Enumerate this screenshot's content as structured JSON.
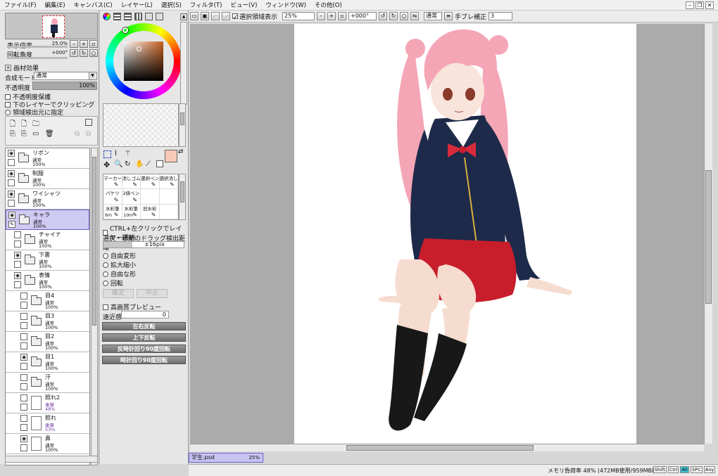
{
  "menu": [
    "ファイル(F)",
    "編集(E)",
    "キャンバス(C)",
    "レイヤー(L)",
    "選択(S)",
    "フィルタ(T)",
    "ビュー(V)",
    "ウィンドウ(W)",
    "その他(O)"
  ],
  "nav": {
    "zoom_label": "表示倍率",
    "zoom_value": "25.0%",
    "rotate_label": "回転角度",
    "rotate_value": "+000°"
  },
  "layer_props": {
    "effects_label": "画材効果",
    "blend_label": "合成モード",
    "blend_value": "通常",
    "opacity_label": "不透明度",
    "opacity_value": "100%",
    "opacity_fraction": 1.0,
    "options": [
      "不透明度保護",
      "下のレイヤーでクリッピング",
      "領域検出元に指定"
    ]
  },
  "layers": [
    {
      "name": "リボン",
      "mode": "通常",
      "opacity": "100%",
      "type": "folder",
      "visible": true,
      "indent": 0,
      "selected": false
    },
    {
      "name": "制服",
      "mode": "通常",
      "opacity": "100%",
      "type": "folder",
      "visible": true,
      "indent": 0,
      "selected": false
    },
    {
      "name": "ワイシャツ",
      "mode": "通常",
      "opacity": "100%",
      "type": "folder",
      "visible": true,
      "indent": 0,
      "selected": false
    },
    {
      "name": "キャラ",
      "mode": "通常",
      "opacity": "100%",
      "type": "folder-open",
      "visible": true,
      "indent": 0,
      "selected": true
    },
    {
      "name": "チャイナ",
      "mode": "通常",
      "opacity": "100%",
      "type": "folder",
      "visible": false,
      "indent": 1,
      "selected": false
    },
    {
      "name": "下書",
      "mode": "通常",
      "opacity": "100%",
      "type": "folder",
      "visible": true,
      "indent": 1,
      "selected": false
    },
    {
      "name": "表情",
      "mode": "通常",
      "opacity": "100%",
      "type": "folder-open",
      "visible": true,
      "indent": 1,
      "selected": false
    },
    {
      "name": "目4",
      "mode": "通常",
      "opacity": "100%",
      "type": "folder",
      "visible": false,
      "indent": 2,
      "selected": false
    },
    {
      "name": "目3",
      "mode": "通常",
      "opacity": "100%",
      "type": "folder",
      "visible": false,
      "indent": 2,
      "selected": false
    },
    {
      "name": "目2",
      "mode": "通常",
      "opacity": "100%",
      "type": "folder",
      "visible": false,
      "indent": 2,
      "selected": false
    },
    {
      "name": "目1",
      "mode": "通常",
      "opacity": "100%",
      "type": "folder",
      "visible": true,
      "indent": 2,
      "selected": false
    },
    {
      "name": "汗",
      "mode": "通常",
      "opacity": "100%",
      "type": "folder",
      "visible": false,
      "indent": 2,
      "selected": false
    },
    {
      "name": "照れ2",
      "mode": "乗算",
      "opacity": "48%",
      "type": "layer",
      "visible": false,
      "indent": 2,
      "selected": false
    },
    {
      "name": "照れ",
      "mode": "乗算",
      "opacity": "53%",
      "type": "layer",
      "visible": false,
      "indent": 2,
      "selected": false
    },
    {
      "name": "鼻",
      "mode": "通常",
      "opacity": "100%",
      "type": "layer",
      "visible": true,
      "indent": 2,
      "selected": false
    }
  ],
  "tools": {
    "brushes": [
      {
        "label": "マーカー"
      },
      {
        "label": "消しゴム"
      },
      {
        "label": "選択ペン"
      },
      {
        "label": "選択消し"
      },
      {
        "label": "バケツ"
      },
      {
        "label": "2値ペン"
      },
      {
        "label": ""
      },
      {
        "label": ""
      },
      {
        "label": "水彩筆",
        "sub": "9ｍ"
      },
      {
        "label": "水彩筆",
        "sub": "10ｍ"
      },
      {
        "label": "旧水彩"
      },
      {
        "label": ""
      }
    ],
    "ctrl_select": "CTRL+左クリックでレイヤー選択",
    "drag_label": "選択・移動のドラッグ検出距離",
    "drag_value": "±16pix",
    "transform_options": [
      "自由変形",
      "拡大縮小",
      "自由な形",
      "回転"
    ],
    "ok_label": "確定",
    "cancel_label": "中止",
    "hq_preview": "高画質プレビュー",
    "perspective_label": "遠近感",
    "perspective_value": "0",
    "actions": [
      "左右反転",
      "上下反転",
      "反時計回り90度回転",
      "時計回り90度回転"
    ]
  },
  "canvas_toolbar": {
    "show_selection": "選択領域表示",
    "zoom": "25%",
    "rotation": "+000°",
    "blend": "通常",
    "stabilizer_label": "手ブレ補正",
    "stabilizer_value": "3"
  },
  "document": {
    "tab_name": "学生.psd",
    "tab_zoom": "25%"
  },
  "status": {
    "memory": "メモリ負荷率 48% (472MB使用/959MB確保)",
    "keys": [
      "Shift",
      "Ctrl",
      "Alt",
      "SPC",
      "Any"
    ]
  },
  "colors": {
    "current": "#f8c9b6",
    "accent": "#6a62c8",
    "hair": "#f4a6b6",
    "uniform": "#1e2a4a",
    "skirt": "#c81e2c",
    "socks": "#181818"
  }
}
